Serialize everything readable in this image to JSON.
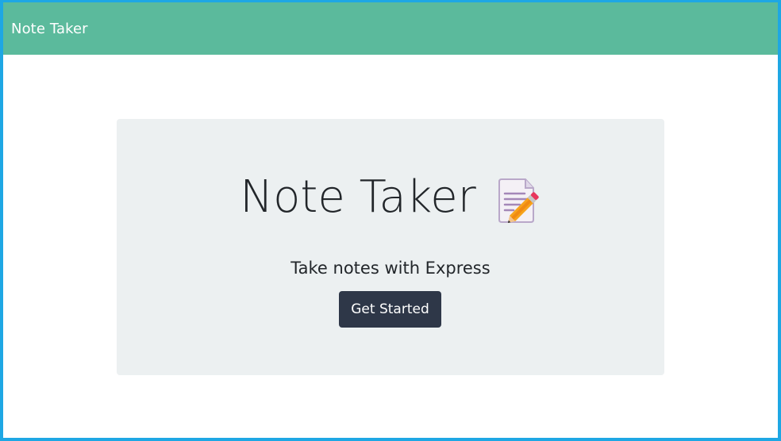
{
  "navbar": {
    "brand": "Note Taker"
  },
  "hero": {
    "title": "Note Taker",
    "title_icon": "memo-pencil-icon",
    "subtitle": "Take notes with Express",
    "button_label": "Get Started"
  },
  "colors": {
    "frame_border": "#1ea7e4",
    "navbar_bg": "#5bba9c",
    "hero_bg": "#ecf0f1",
    "button_bg": "#2e3748",
    "text": "#22262a"
  }
}
